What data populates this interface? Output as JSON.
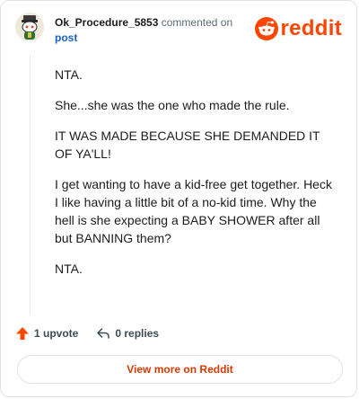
{
  "header": {
    "username": "Ok_Procedure_5853",
    "commented_on": "commented on",
    "post_link": "post",
    "brand": "reddit"
  },
  "comment": {
    "paragraphs": [
      "NTA.",
      "She...she was the one who made the rule.",
      "IT WAS MADE BECAUSE SHE DEMANDED IT OF YA'LL!",
      "I get wanting to have a kid-free get together. Heck I like having a little bit of a no-kid time. Why the hell is she expecting a BABY SHOWER after all but BANNING them?",
      "NTA."
    ]
  },
  "actions": {
    "upvote_label": "1 upvote",
    "replies_label": "0 replies"
  },
  "footer": {
    "view_more_label": "View more on Reddit"
  },
  "colors": {
    "brand_orange": "#ff4500",
    "link_blue": "#1a5fc2",
    "cta_text": "#d93900"
  },
  "icons": {
    "avatar": "snoo-avatar-icon",
    "logo": "reddit-snoo-icon",
    "upvote": "upvote-arrow-icon",
    "reply": "reply-arrow-icon"
  }
}
